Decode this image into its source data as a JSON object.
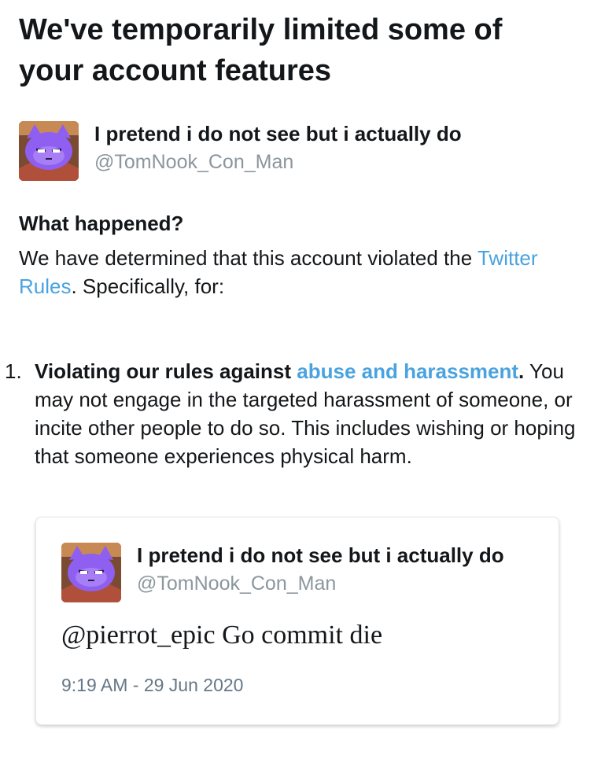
{
  "page": {
    "title": "We've temporarily limited some of your account features"
  },
  "account": {
    "display_name": "I pretend i do not see but i actually do",
    "screen_name": "@TomNook_Con_Man",
    "avatar_icon": "purple-cat-avatar"
  },
  "what_happened": {
    "heading": "What happened?",
    "text_before_link": "We have determined that this account violated the ",
    "link_text": "Twitter Rules",
    "text_after_link": ". Specifically, for:"
  },
  "violations": [
    {
      "number": "1.",
      "title_prefix": "Violating our rules against ",
      "title_link": "abuse and harassment",
      "title_suffix": ".",
      "description": "You may not engage in the targeted harassment of someone, or incite other people to do so. This includes wishing or hoping that someone experiences physical harm."
    }
  ],
  "tweet": {
    "display_name": "I pretend i do not see but i actually do",
    "screen_name": "@TomNook_Con_Man",
    "text": "@pierrot_epic Go commit die",
    "timestamp": "9:19 AM - 29 Jun 2020"
  },
  "colors": {
    "link": "#4aa3df",
    "text": "#14171a",
    "secondary_text": "#8b969d",
    "avatar_purple": "#8e5ff0"
  }
}
